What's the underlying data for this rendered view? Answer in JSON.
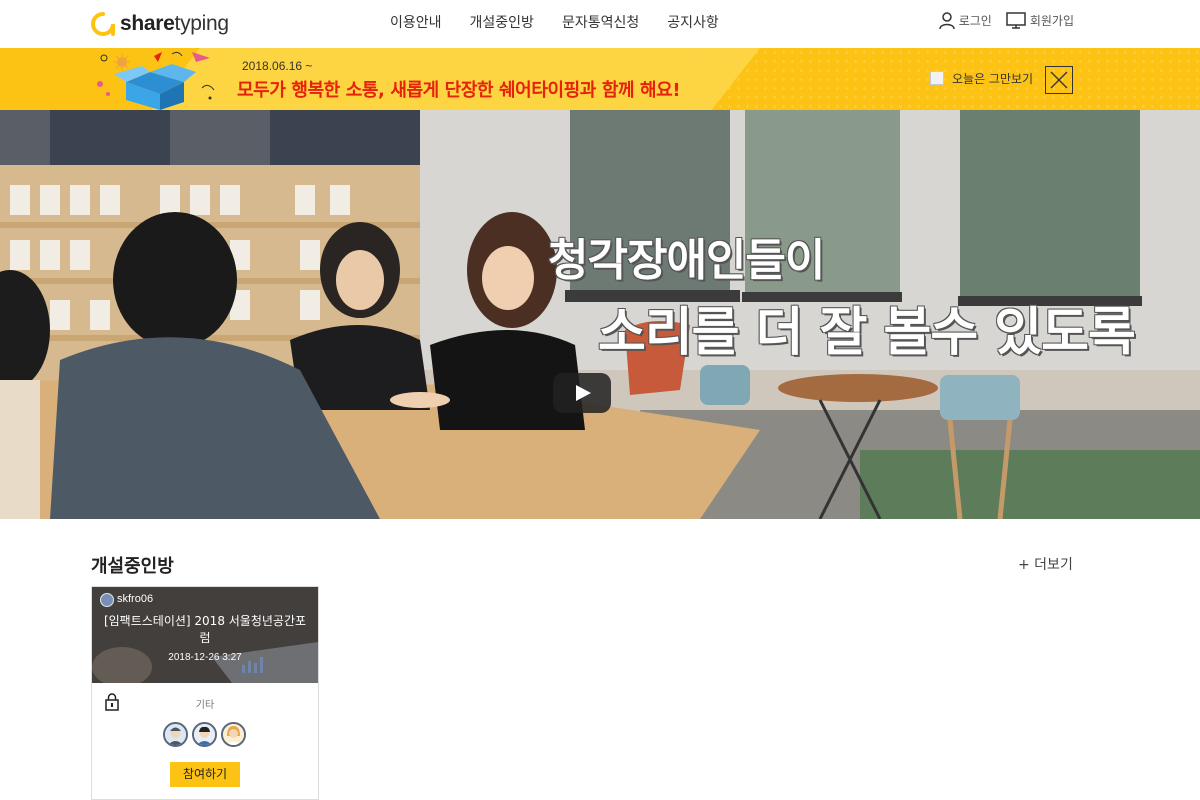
{
  "header": {
    "logo_text_bold": "share",
    "logo_text_rest": "typing",
    "nav": [
      "이용안내",
      "개설중인방",
      "문자통역신청",
      "공지사항"
    ],
    "login_label": "로그인",
    "signup_label": "회원가입"
  },
  "banner": {
    "date": "2018.06.16 ~",
    "title": "모두가 행복한 소통, 새롭게 단장한 쉐어타이핑과 함께 해요!",
    "hide_today_label": "오늘은 그만보기",
    "colors": {
      "background": "#fcc314",
      "title": "#e7220b"
    }
  },
  "hero": {
    "caption_line1": "청각장애인들이",
    "caption_line2": "소리를 더 잘 볼수 있도록"
  },
  "section": {
    "title": "개설중인방",
    "more_label": "+ 더보기"
  },
  "room_card": {
    "owner": "skfro06",
    "title": "[임팩트스테이션] 2018 서울청년공간포럼",
    "date": "2018-12-26 3:27",
    "category": "기타",
    "join_label": "참여하기",
    "icons": [
      "lock-icon",
      "avatar-1",
      "avatar-2",
      "avatar-3"
    ]
  }
}
